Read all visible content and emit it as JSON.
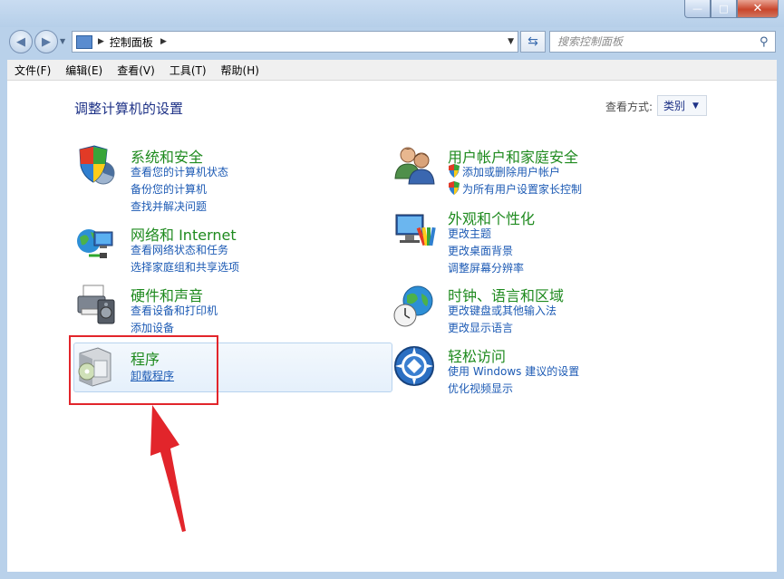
{
  "window": {
    "caption": {
      "minimize": "—",
      "maximize": "□",
      "close": "✕"
    }
  },
  "address": {
    "path_label": "控制面板",
    "search_placeholder": "搜索控制面板"
  },
  "menu": [
    "文件(F)",
    "编辑(E)",
    "查看(V)",
    "工具(T)",
    "帮助(H)"
  ],
  "main": {
    "heading": "调整计算机的设置",
    "view_by_label": "查看方式:",
    "view_by_value": "类别"
  },
  "categories": {
    "system": {
      "title": "系统和安全",
      "links": [
        "查看您的计算机状态",
        "备份您的计算机",
        "查找并解决问题"
      ]
    },
    "network": {
      "title": "网络和 Internet",
      "links": [
        "查看网络状态和任务",
        "选择家庭组和共享选项"
      ]
    },
    "hardware": {
      "title": "硬件和声音",
      "links": [
        "查看设备和打印机",
        "添加设备"
      ]
    },
    "programs": {
      "title": "程序",
      "links": [
        "卸载程序"
      ]
    },
    "users": {
      "title": "用户帐户和家庭安全",
      "links": [
        "添加或删除用户帐户",
        "为所有用户设置家长控制"
      ]
    },
    "appearance": {
      "title": "外观和个性化",
      "links": [
        "更改主题",
        "更改桌面背景",
        "调整屏幕分辨率"
      ]
    },
    "clock": {
      "title": "时钟、语言和区域",
      "links": [
        "更改键盘或其他输入法",
        "更改显示语言"
      ]
    },
    "ease": {
      "title": "轻松访问",
      "links": [
        "使用 Windows 建议的设置",
        "优化视频显示"
      ]
    }
  },
  "colors": {
    "accent_red": "#e2252b",
    "title_green": "#1e8a1e",
    "link_blue": "#1c5ab4"
  }
}
